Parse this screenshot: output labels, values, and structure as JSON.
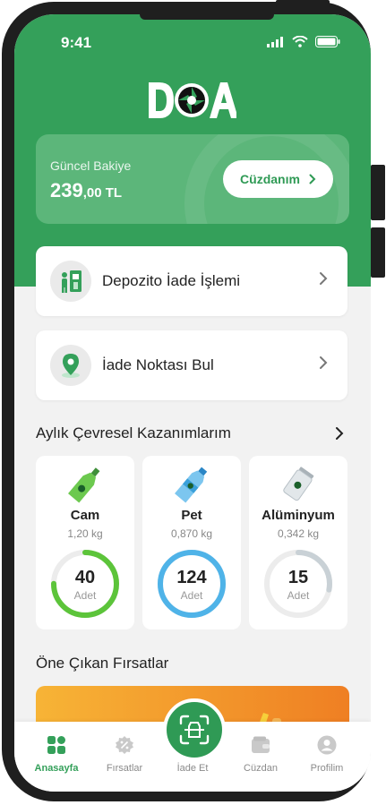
{
  "status": {
    "time": "9:41"
  },
  "balance": {
    "label": "Güncel Bakiye",
    "amount_main": "239",
    "amount_rest": ",00 TL",
    "wallet_button": "Cüzdanım"
  },
  "actions": [
    {
      "label": "Depozito İade İşlemi",
      "icon": "deposit-return-icon"
    },
    {
      "label": "İade Noktası Bul",
      "icon": "location-pin-icon"
    }
  ],
  "monthly": {
    "title": "Aylık Çevresel Kazanımlarım",
    "items": [
      {
        "name": "Cam",
        "weight": "1,20 kg",
        "count": "40",
        "unit": "Adet",
        "color": "#5cc43a",
        "progress": 0.75
      },
      {
        "name": "Pet",
        "weight": "0,870 kg",
        "count": "124",
        "unit": "Adet",
        "color": "#4fb3e8",
        "progress": 1.0
      },
      {
        "name": "Alüminyum",
        "weight": "0,342 kg",
        "count": "15",
        "unit": "Adet",
        "color": "#c9d1d6",
        "progress": 0.28
      }
    ]
  },
  "offers": {
    "title": "Öne Çıkan Fırsatlar"
  },
  "nav": [
    {
      "label": "Anasayfa",
      "active": true
    },
    {
      "label": "Fırsatlar",
      "active": false
    },
    {
      "label": "İade Et",
      "active": false
    },
    {
      "label": "Cüzdan",
      "active": false
    },
    {
      "label": "Profilim",
      "active": false
    }
  ],
  "colors": {
    "brand": "#34a05a",
    "brand_dark": "#2f9a55"
  }
}
